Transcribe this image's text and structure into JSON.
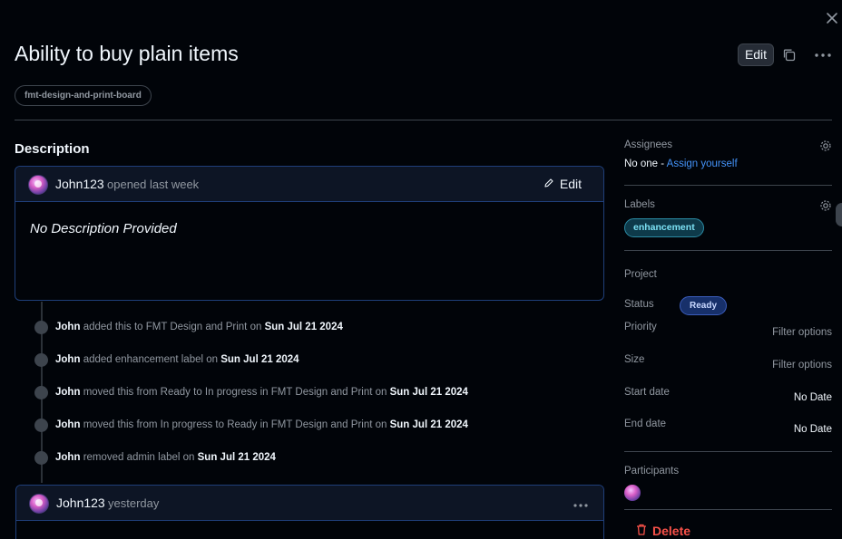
{
  "issue": {
    "title": "Ability to buy plain items",
    "edit_label": "Edit",
    "repo_tag": "fmt-design-and-print-board"
  },
  "description": {
    "heading": "Description",
    "author": "John123",
    "opened": "opened last week",
    "edit_label": "Edit",
    "body": "No Description Provided"
  },
  "timeline": [
    {
      "user": "John",
      "action": "added this to FMT Design and Print on",
      "date": "Sun Jul 21 2024"
    },
    {
      "user": "John",
      "action": "added enhancement label on",
      "date": "Sun Jul 21 2024"
    },
    {
      "user": "John",
      "action": "moved this from Ready to In progress in FMT Design and Print on",
      "date": "Sun Jul 21 2024"
    },
    {
      "user": "John",
      "action": "moved this from In progress to Ready in FMT Design and Print on",
      "date": "Sun Jul 21 2024"
    },
    {
      "user": "John",
      "action": "removed admin label on",
      "date": "Sun Jul 21 2024"
    }
  ],
  "comment": {
    "author": "John123",
    "when": "yesterday"
  },
  "sidebar": {
    "assignees_label": "Assignees",
    "no_one": "No one -",
    "assign_yourself": "Assign yourself",
    "labels_label": "Labels",
    "label_value": "enhancement",
    "project_label": "Project",
    "status_label": "Status",
    "status_value": "Ready",
    "priority_label": "Priority",
    "priority_value": "Filter options",
    "size_label": "Size",
    "size_value": "Filter options",
    "start_label": "Start date",
    "start_value": "No Date",
    "end_label": "End date",
    "end_value": "No Date",
    "participants_label": "Participants",
    "delete_label": "Delete"
  },
  "colors": {
    "background": "#010409",
    "accent_border": "#1f3f7a",
    "link": "#4493f8",
    "danger": "#f85149",
    "label_enhancement": "#7ce2f5",
    "status_ready": "#17306a"
  }
}
